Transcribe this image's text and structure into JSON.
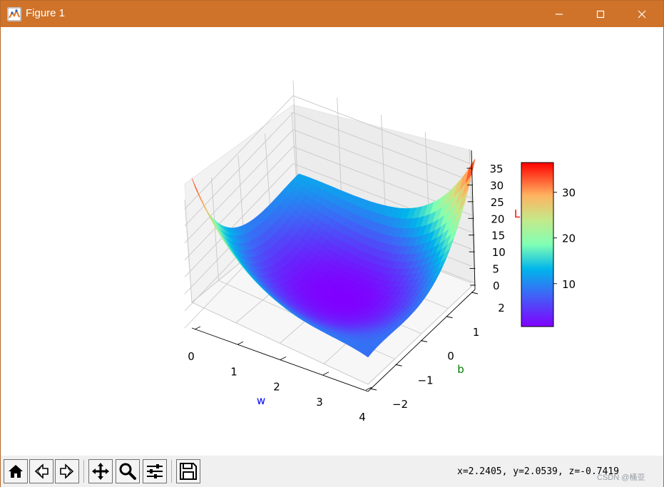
{
  "window": {
    "title": "Figure 1"
  },
  "status": {
    "coordinates": "x=2.2405, y=2.0539, z=-0.7419"
  },
  "watermark": "CSDN @桶亚",
  "toolbar": {
    "buttons": [
      "home",
      "back",
      "forward",
      "pan",
      "zoom",
      "configure-subplots",
      "save"
    ]
  },
  "chart_data": {
    "type": "surface",
    "colormap": "rainbow",
    "xlabel": "w",
    "ylabel": "b",
    "zlabel": "L",
    "xlabel_color": "#0000ff",
    "ylabel_color": "#008000",
    "zlabel_color": "#ff0000",
    "x_ticks": [
      "0",
      "1",
      "2",
      "3",
      "4"
    ],
    "y_ticks": [
      "−2",
      "−1",
      "0",
      "1",
      "2"
    ],
    "z_ticks": [
      "0",
      "5",
      "10",
      "15",
      "20",
      "25",
      "30",
      "35"
    ],
    "xlim": [
      0,
      4
    ],
    "ylim": [
      -2,
      2
    ],
    "zlim": [
      0,
      36.5
    ],
    "colorbar": {
      "ticks": [
        "10",
        "20",
        "30"
      ],
      "min": 0.6,
      "max": 36.5
    },
    "surface_corners": [
      {
        "w": 0,
        "b": -2,
        "L": 36.5
      },
      {
        "w": 4,
        "b": 2,
        "L": 36.5
      },
      {
        "w": 0,
        "b": 2,
        "L": 12
      },
      {
        "w": 4,
        "b": -2,
        "L": 8
      }
    ],
    "minimum": {
      "w": 2.2,
      "b": 0,
      "L": 0.6
    }
  }
}
